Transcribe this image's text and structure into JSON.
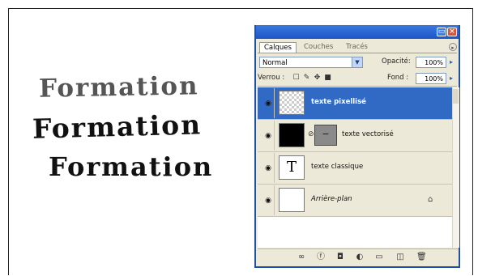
{
  "words": [
    "Formation",
    "Formation",
    "Formation"
  ],
  "panel": {
    "tabs": [
      {
        "label": "Calques",
        "active": true
      },
      {
        "label": "Couches",
        "active": false
      },
      {
        "label": "Tracés",
        "active": false
      }
    ],
    "blend_mode": "Normal",
    "opacity_label": "Opacité:",
    "opacity_value": "100%",
    "lock_label": "Verrou :",
    "fill_label": "Fond :",
    "fill_value": "100%",
    "layers": [
      {
        "name": "texte pixellisé",
        "selected": true
      },
      {
        "name": "texte vectorisé",
        "selected": false
      },
      {
        "name": "texte classique",
        "selected": false
      },
      {
        "name": "Arrière-plan",
        "selected": false
      }
    ],
    "text_layer_glyph": "T"
  },
  "colors": {
    "selection": "#316ac5",
    "titlebar": "#1d56c8",
    "panel_bg": "#ece9d8"
  }
}
